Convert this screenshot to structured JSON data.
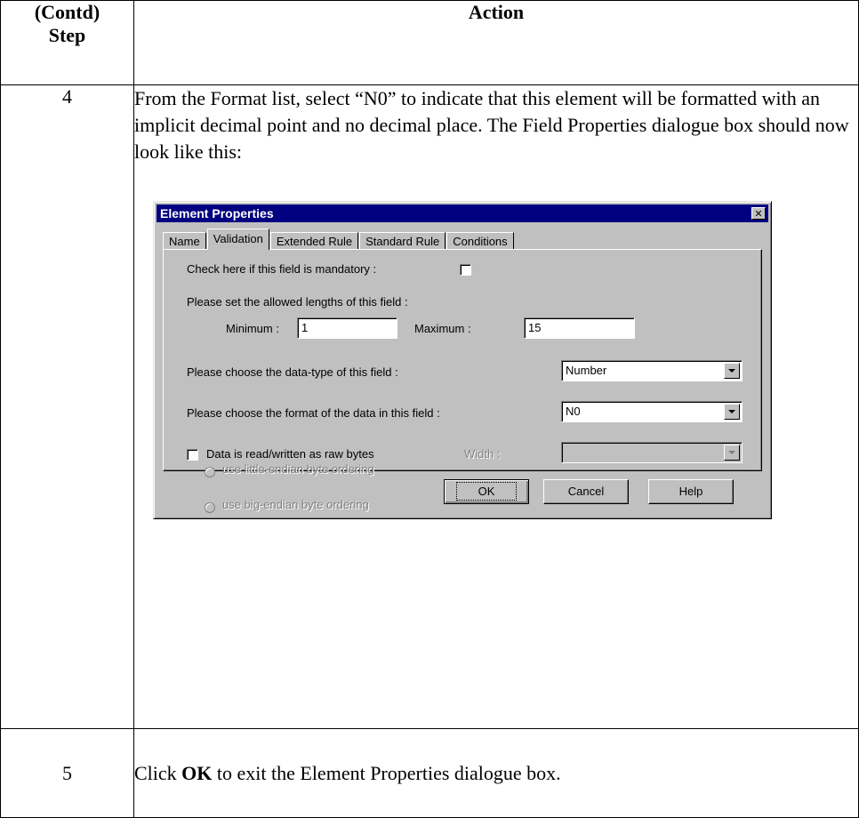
{
  "table": {
    "header": {
      "step": [
        "(Contd)",
        "Step"
      ],
      "action": "Action"
    },
    "rows": [
      {
        "step": "4",
        "text": "From the Format list, select “N0” to indicate that this element will be formatted with an implicit decimal point and no decimal place. The Field Properties dialogue box should now look like this:"
      },
      {
        "step": "5",
        "text_before": "Click ",
        "text_bold": "OK",
        "text_after": " to exit the Element Properties dialogue box."
      }
    ]
  },
  "dialog": {
    "title": "Element Properties",
    "close_glyph": "✕",
    "tabs": [
      "Name",
      "Validation",
      "Extended Rule",
      "Standard Rule",
      "Conditions"
    ],
    "active_tab": "Validation",
    "mandatory_label": "Check here if this field is mandatory :",
    "mandatory_checked": false,
    "lengths_label": "Please set the allowed lengths of this field :",
    "minimum_label": "Minimum :",
    "minimum_value": "1",
    "maximum_label": "Maximum :",
    "maximum_value": "15",
    "datatype_label": "Please choose the data-type of this field :",
    "datatype_value": "Number",
    "format_label": "Please choose the format of the data in this field :",
    "format_value": "N0",
    "raw_bytes_label": "Data is read/written as raw bytes",
    "raw_bytes_checked": false,
    "width_label": "Width :",
    "width_value": "",
    "little_endian_label": "use little-endian byte ordering",
    "big_endian_label": "use big-endian byte ordering",
    "buttons": {
      "ok": "OK",
      "cancel": "Cancel",
      "help": "Help"
    }
  }
}
